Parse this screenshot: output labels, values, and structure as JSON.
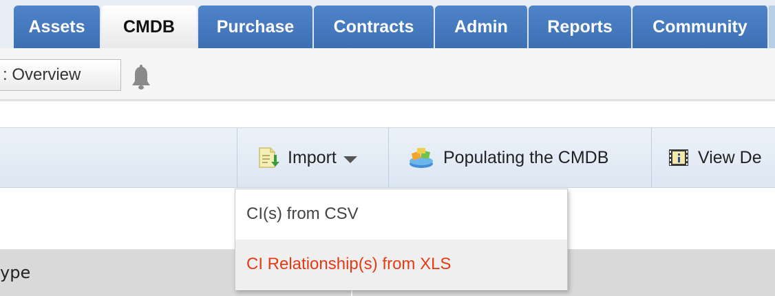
{
  "tabs": [
    {
      "label": "Assets",
      "active": false
    },
    {
      "label": "CMDB",
      "active": true
    },
    {
      "label": "Purchase",
      "active": false
    },
    {
      "label": "Contracts",
      "active": false
    },
    {
      "label": "Admin",
      "active": false
    },
    {
      "label": "Reports",
      "active": false
    },
    {
      "label": "Community",
      "active": false
    }
  ],
  "subbar": {
    "overview_label": ": Overview",
    "notification_icon": "bell-icon"
  },
  "toolbar": {
    "import_label": "Import",
    "import_icon": "import-icon",
    "populate_label": "Populating the CMDB",
    "populate_icon": "populate-cmdb-icon",
    "view_label": "View De",
    "view_icon": "view-details-icon"
  },
  "import_menu": {
    "items": [
      {
        "label": "CI(s) from CSV",
        "highlighted": false
      },
      {
        "label": "CI Relationship(s) from XLS",
        "highlighted": true
      }
    ],
    "highlight_color": "#e53a16"
  },
  "grid": {
    "column_type_label": "ype"
  },
  "colors": {
    "tab_blue": "#3d6fb3",
    "toolbar_bg": "#dde7f3"
  }
}
